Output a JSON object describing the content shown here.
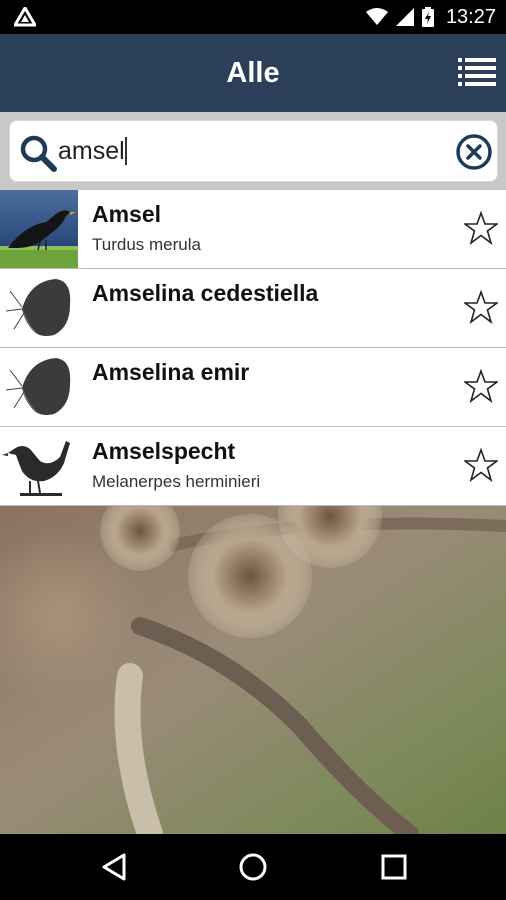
{
  "status_bar": {
    "time": "13:27"
  },
  "header": {
    "title": "Alle",
    "menu_icon": "list-menu-icon"
  },
  "search": {
    "value": "amsel",
    "placeholder": "",
    "search_icon": "search-icon",
    "clear_icon": "clear-circle-x-icon"
  },
  "results": [
    {
      "name": "Amsel",
      "scientific": "Turdus merula",
      "thumb": "blackbird-photo",
      "favorite": false
    },
    {
      "name": "Amselina cedestiella",
      "scientific": "",
      "thumb": "moth-silhouette",
      "favorite": false
    },
    {
      "name": "Amselina emir",
      "scientific": "",
      "thumb": "moth-silhouette",
      "favorite": false
    },
    {
      "name": "Amselspecht",
      "scientific": "Melanerpes herminieri",
      "thumb": "bird-silhouette",
      "favorite": false
    }
  ],
  "navigation": {
    "back_icon": "back-triangle-icon",
    "home_icon": "home-circle-icon",
    "recents_icon": "recents-square-icon"
  },
  "colors": {
    "app_bar": "#2b3f58",
    "search_band": "#c8c8c8",
    "list_background": "#ffffff",
    "status_bar": "#000000",
    "icon_dark": "#1f3a57"
  }
}
